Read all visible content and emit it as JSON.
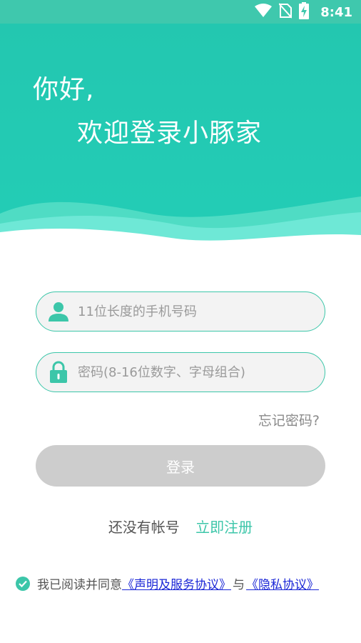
{
  "status_bar": {
    "time": "8:41",
    "icons": [
      "wifi-icon",
      "no-sim-icon",
      "battery-charging-icon"
    ]
  },
  "hero": {
    "greeting": "你好,",
    "welcome": "欢迎登录小豚家"
  },
  "form": {
    "phone_placeholder": "11位长度的手机号码",
    "password_placeholder": "密码(8-16位数字、字母组合)",
    "forgot_password": "忘记密码?",
    "login_label": "登录"
  },
  "register": {
    "question": "还没有帐号",
    "link": "立即注册"
  },
  "agreement": {
    "prefix": "我已阅读并同意",
    "terms_link": "《声明及服务协议》",
    "joiner": "与",
    "privacy_link": "《隐私协议》"
  },
  "colors": {
    "accent": "#3cc6a9",
    "hero_bg": "#23c7b0",
    "status_bar": "#3fc8ad",
    "button_disabled": "#cdcdcd",
    "link_blue": "#1a26d6"
  }
}
